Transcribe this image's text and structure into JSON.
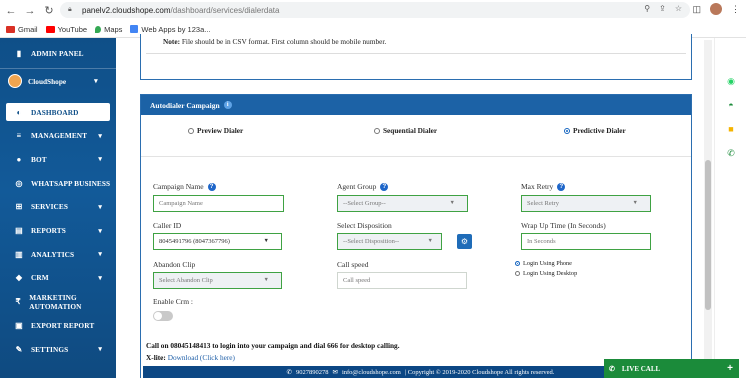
{
  "browser": {
    "url_host": "panelv2.cloudshope.com",
    "url_path": "/dashboard/services/dialerdata",
    "bookmarks": [
      {
        "label": "Gmail",
        "icon": "gmail-icon",
        "color": "#d93025"
      },
      {
        "label": "YouTube",
        "icon": "youtube-icon",
        "color": "#ff0000"
      },
      {
        "label": "Maps",
        "icon": "maps-icon",
        "color": "#34a853"
      },
      {
        "label": "Web Apps by 123a...",
        "icon": "apps-icon",
        "color": "#4285f4"
      }
    ]
  },
  "sidebar": {
    "header": "ADMIN PANEL",
    "user": "CloudShope",
    "items": [
      {
        "label": "DASHBOARD",
        "icon": "speedometer-icon",
        "glyph": "◐",
        "chevron": false,
        "active": true
      },
      {
        "label": "MANAGEMENT",
        "icon": "list-icon",
        "glyph": "≡",
        "chevron": true,
        "active": false
      },
      {
        "label": "BOT",
        "icon": "robot-icon",
        "glyph": "●",
        "chevron": true,
        "active": false
      },
      {
        "label": "WHATSAPP BUSINESS",
        "icon": "whatsapp-icon",
        "glyph": "◎",
        "chevron": false,
        "active": false
      },
      {
        "label": "SERVICES",
        "icon": "cart-icon",
        "glyph": "⊞",
        "chevron": true,
        "active": false
      },
      {
        "label": "REPORTS",
        "icon": "report-icon",
        "glyph": "▤",
        "chevron": true,
        "active": false
      },
      {
        "label": "ANALYTICS",
        "icon": "analytics-icon",
        "glyph": "▥",
        "chevron": true,
        "active": false
      },
      {
        "label": "CRM",
        "icon": "users-icon",
        "glyph": "◆",
        "chevron": true,
        "active": false
      },
      {
        "label": "MARKETING AUTOMATION",
        "icon": "rupee-icon",
        "glyph": "₹",
        "chevron": false,
        "active": false
      },
      {
        "label": "EXPORT REPORT",
        "icon": "database-icon",
        "glyph": "▣",
        "chevron": false,
        "active": false
      },
      {
        "label": "SETTINGS",
        "icon": "wrench-icon",
        "glyph": "✎",
        "chevron": true,
        "active": false
      }
    ]
  },
  "note": {
    "prefix": "Note:",
    "text": "File should be in CSV format. First column should be mobile number."
  },
  "campaign": {
    "title": "Autodialer Campaign",
    "dialer_options": [
      {
        "label": "Preview Dialer",
        "selected": false
      },
      {
        "label": "Sequential Dialer",
        "selected": false
      },
      {
        "label": "Predictive Dialer",
        "selected": true
      }
    ],
    "labels": {
      "campaign_name": "Campaign Name",
      "agent_group": "Agent Group",
      "max_retry": "Max Retry",
      "caller_id": "Caller ID",
      "select_disposition": "Select Disposition",
      "wrap_up_time": "Wrap Up Time (In Seconds)",
      "abandon_clip": "Abandon Clip",
      "call_speed": "Call speed",
      "enable_crm": "Enable Crm :"
    },
    "fields": {
      "campaign_name_placeholder": "Campaign Name",
      "agent_group_value": "--Select Group--",
      "max_retry_value": "Select Retry",
      "caller_id_value": "8045491796 (8047367796)",
      "disposition_value": "--Select Disposition--",
      "wrap_up_placeholder": "In Seconds",
      "abandon_clip_value": "Select Abandon Clip",
      "call_speed_placeholder": "Call speed"
    },
    "login_options": [
      {
        "label": "Login Using Phone",
        "selected": true
      },
      {
        "label": "Login Using Desktop",
        "selected": false
      }
    ],
    "enable_crm_on": false,
    "call_instruction": "Call on 08045148413 to login into your campaign and dial 666 for desktop calling.",
    "xlite_label": "X-lite:",
    "xlite_link": "Download (Click here)"
  },
  "footer": {
    "phone": "9027890278",
    "email": "info@cloudshope.com",
    "copyright": "| Copyright © 2019-2020 Cloudshope All rights reserved."
  },
  "live_chat": {
    "label": "LIVE CALL"
  },
  "colors": {
    "sidebar": "#0f4f88",
    "panel_header": "#1c62a6",
    "field_border": "#3fa243",
    "live_call": "#1b8b3a"
  }
}
